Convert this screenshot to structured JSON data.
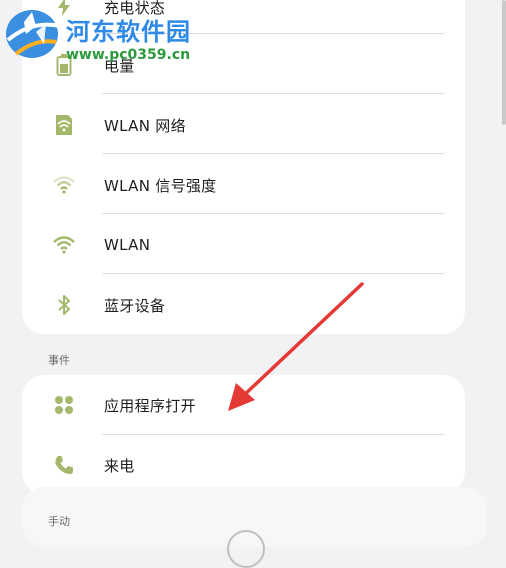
{
  "watermark": {
    "title": "河东软件园",
    "url": "www.pc0359.cn"
  },
  "group_status": {
    "items": [
      {
        "label": "充电状态",
        "icon": "charging-icon"
      },
      {
        "label": "电量",
        "icon": "battery-icon"
      },
      {
        "label": "WLAN 网络",
        "icon": "wlan-network-icon"
      },
      {
        "label": "WLAN 信号强度",
        "icon": "wifi-signal-icon"
      },
      {
        "label": "WLAN",
        "icon": "wifi-icon"
      },
      {
        "label": "蓝牙设备",
        "icon": "bluetooth-icon"
      }
    ]
  },
  "section_events": {
    "label": "事件"
  },
  "group_events": {
    "items": [
      {
        "label": "应用程序打开",
        "icon": "apps-icon"
      },
      {
        "label": "来电",
        "icon": "phone-icon"
      }
    ]
  },
  "section_manual": {
    "label": "手动"
  },
  "colors": {
    "icon_accent": "#a4b86b",
    "arrow": "#e53935",
    "card": "#ffffff",
    "background": "#f2f2f4"
  }
}
